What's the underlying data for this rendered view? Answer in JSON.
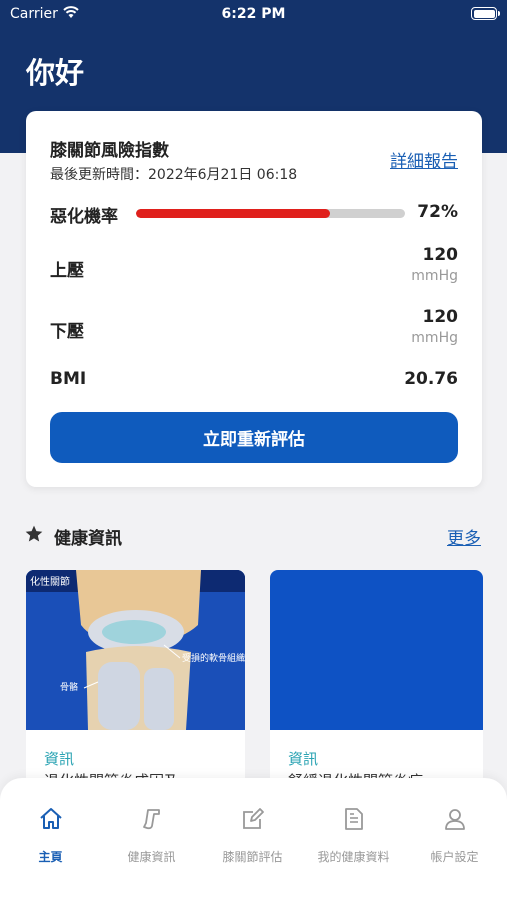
{
  "status_bar": {
    "carrier": "Carrier",
    "time": "6:22 PM"
  },
  "header": {
    "greeting": "你好"
  },
  "risk_card": {
    "title": "膝關節風險指數",
    "updated_label": "最後更新時間：2022年6月21日 06:18",
    "report_link": "詳細報告",
    "deterioration": {
      "label": "惡化機率",
      "value": "72%",
      "fraction": 0.72
    },
    "systolic": {
      "label": "上壓",
      "value": "120",
      "unit": "mmHg"
    },
    "diastolic": {
      "label": "下壓",
      "value": "120",
      "unit": "mmHg"
    },
    "bmi": {
      "label": "BMI",
      "value": "20.76"
    },
    "reassess_button": "立即重新評估"
  },
  "news": {
    "section_title": "健康資訊",
    "more_link": "更多",
    "items": [
      {
        "tag": "資訊",
        "title": "退化性關節炎成因及",
        "image_caption_top": "化性關節",
        "image_caption_damaged": "受損的軟骨組織",
        "image_caption_bone": "骨骼"
      },
      {
        "tag": "資訊",
        "title": "舒緩退化性關節炎症"
      }
    ]
  },
  "tab_bar": {
    "items": [
      {
        "label": "主頁",
        "icon": "home-icon",
        "active": true
      },
      {
        "label": "健康資訊",
        "icon": "music-note-icon",
        "active": false
      },
      {
        "label": "膝關節評估",
        "icon": "edit-icon",
        "active": false
      },
      {
        "label": "我的健康資料",
        "icon": "document-icon",
        "active": false
      },
      {
        "label": "帳户設定",
        "icon": "user-icon",
        "active": false
      }
    ]
  },
  "colors": {
    "header": "#14336b",
    "accent": "#0f5bbd",
    "progress": "#e0201c",
    "tag": "#2aa3b3"
  }
}
